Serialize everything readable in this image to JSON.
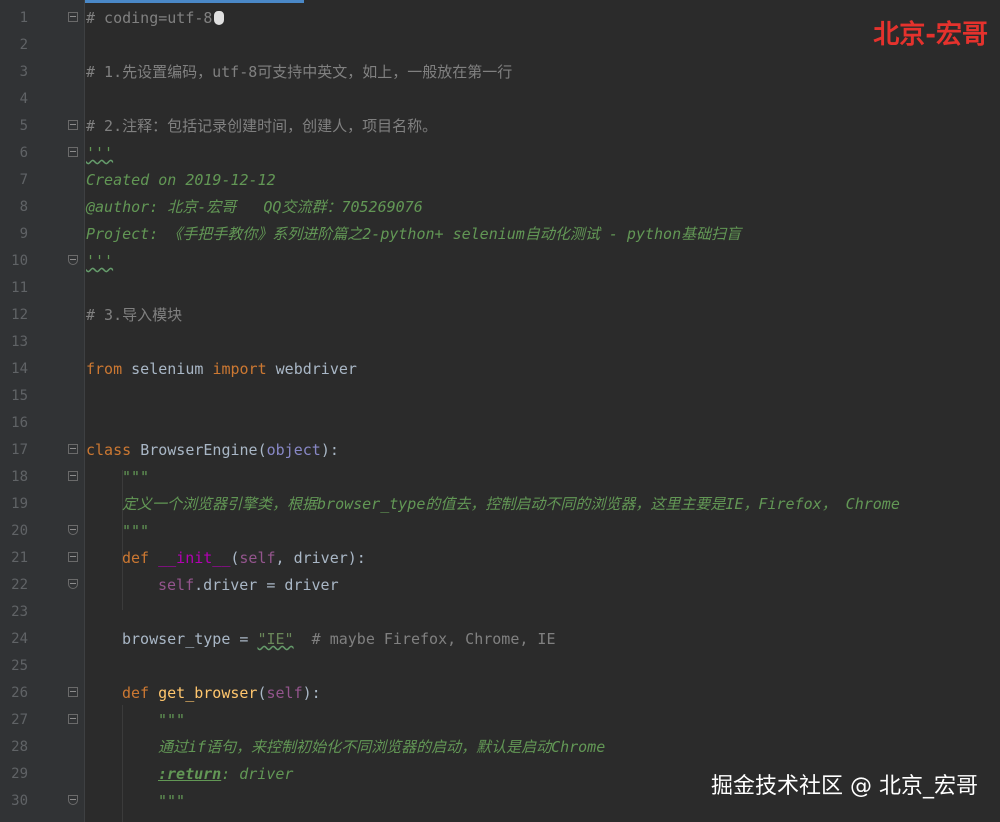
{
  "editor": {
    "lines": [
      {
        "n": "1",
        "segs": [
          [
            "c-comment",
            "# coding=utf-8"
          ]
        ],
        "fold": "start"
      },
      {
        "n": "2",
        "segs": []
      },
      {
        "n": "3",
        "segs": [
          [
            "c-comment",
            "# 1.先设置编码，utf-8可支持中英文，如上，一般放在第一行"
          ]
        ]
      },
      {
        "n": "4",
        "segs": []
      },
      {
        "n": "5",
        "segs": [
          [
            "c-comment",
            "# 2.注释：包括记录创建时间，创建人，项目名称。"
          ]
        ],
        "fold": "start"
      },
      {
        "n": "6",
        "segs": [
          [
            "c-doc wavy",
            "'''"
          ]
        ],
        "fold": "start"
      },
      {
        "n": "7",
        "segs": [
          [
            "c-doc",
            "Created on 2019-12-12"
          ]
        ]
      },
      {
        "n": "8",
        "segs": [
          [
            "c-doc",
            "@author: 北京-宏哥   QQ交流群：705269076"
          ]
        ]
      },
      {
        "n": "9",
        "segs": [
          [
            "c-doc",
            "Project: 《手把手教你》系列进阶篇之2-python+ selenium自动化测试 - python基础扫盲"
          ]
        ]
      },
      {
        "n": "10",
        "segs": [
          [
            "c-doc wavy",
            "'''"
          ]
        ],
        "fold": "end"
      },
      {
        "n": "11",
        "segs": []
      },
      {
        "n": "12",
        "segs": [
          [
            "c-comment",
            "# 3.导入模块"
          ]
        ]
      },
      {
        "n": "13",
        "segs": []
      },
      {
        "n": "14",
        "segs": [
          [
            "c-kw",
            "from "
          ],
          [
            "c-text",
            "selenium "
          ],
          [
            "c-kw",
            "import "
          ],
          [
            "c-text",
            "webdriver"
          ]
        ]
      },
      {
        "n": "15",
        "segs": []
      },
      {
        "n": "16",
        "segs": []
      },
      {
        "n": "17",
        "segs": [
          [
            "c-kw",
            "class "
          ],
          [
            "c-text",
            "BrowserEngine("
          ],
          [
            "c-builtin",
            "object"
          ],
          [
            "c-text",
            "):"
          ]
        ],
        "fold": "start"
      },
      {
        "n": "18",
        "indent": 1,
        "segs": [
          [
            "c-doc",
            "\"\"\""
          ]
        ],
        "fold": "start"
      },
      {
        "n": "19",
        "indent": 1,
        "segs": [
          [
            "c-doc",
            "定义一个浏览器引擎类，根据browser_type的值去，控制启动不同的浏览器，这里主要是IE，Firefox， Chrome"
          ]
        ]
      },
      {
        "n": "20",
        "indent": 1,
        "segs": [
          [
            "c-doc",
            "\"\"\""
          ]
        ],
        "fold": "end"
      },
      {
        "n": "21",
        "indent": 1,
        "segs": [
          [
            "c-kw",
            "def "
          ],
          [
            "c-magic",
            "__init__"
          ],
          [
            "c-text",
            "("
          ],
          [
            "c-self",
            "self"
          ],
          [
            "c-text",
            ", driver):"
          ]
        ],
        "fold": "start"
      },
      {
        "n": "22",
        "indent": 2,
        "segs": [
          [
            "c-self",
            "self"
          ],
          [
            "c-text",
            ".driver = driver"
          ]
        ],
        "fold": "end"
      },
      {
        "n": "23",
        "segs": []
      },
      {
        "n": "24",
        "indent": 1,
        "segs": [
          [
            "c-text",
            "browser_type = "
          ],
          [
            "c-str wavy",
            "\"IE\""
          ],
          [
            "c-comment",
            "  # maybe Firefox, Chrome, IE"
          ]
        ]
      },
      {
        "n": "25",
        "segs": []
      },
      {
        "n": "26",
        "indent": 1,
        "segs": [
          [
            "c-kw",
            "def "
          ],
          [
            "c-fn",
            "get_browser"
          ],
          [
            "c-text",
            "("
          ],
          [
            "c-self",
            "self"
          ],
          [
            "c-text",
            "):"
          ]
        ],
        "fold": "start"
      },
      {
        "n": "27",
        "indent": 2,
        "segs": [
          [
            "c-doc",
            "\"\"\""
          ]
        ],
        "fold": "start"
      },
      {
        "n": "28",
        "indent": 2,
        "segs": [
          [
            "c-doc",
            "通过if语句，来控制初始化不同浏览器的启动，默认是启动Chrome"
          ]
        ]
      },
      {
        "n": "29",
        "indent": 2,
        "segs": [
          [
            "c-tag",
            ":return"
          ],
          [
            "c-doc",
            ": driver"
          ]
        ]
      },
      {
        "n": "30",
        "indent": 2,
        "segs": [
          [
            "c-doc",
            "\"\"\""
          ]
        ],
        "fold": "end"
      }
    ]
  },
  "watermarks": {
    "top": "北京-宏哥",
    "bottom": "掘金技术社区 @ 北京_宏哥"
  },
  "colors": {
    "background": "#2b2b2b",
    "keyword": "#cc7832",
    "docstring": "#629755",
    "comment": "#808080",
    "watermark_red": "#e5322d"
  }
}
